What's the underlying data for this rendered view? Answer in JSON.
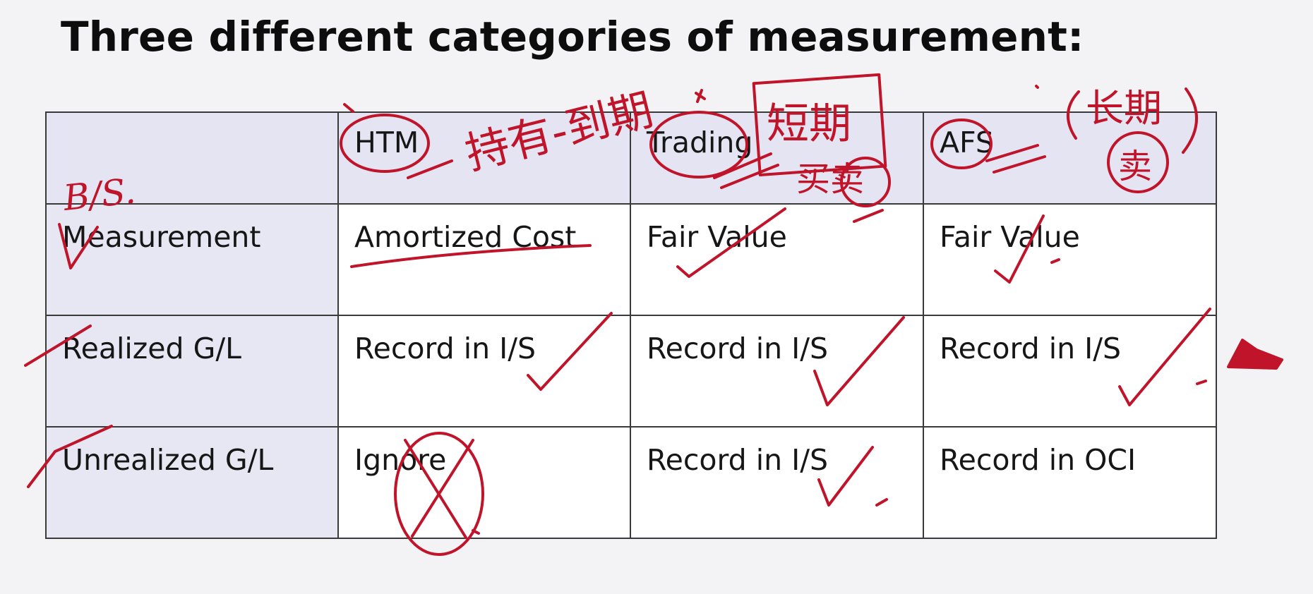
{
  "slide": {
    "title": "Three different categories of measurement:"
  },
  "table": {
    "columns": [
      "",
      "HTM",
      "Trading",
      "AFS"
    ],
    "rows": [
      {
        "label": "Measurement",
        "cells": [
          "Amortized Cost",
          "Fair Value",
          "Fair Value"
        ]
      },
      {
        "label": "Realized G/L",
        "cells": [
          "Record in I/S",
          "Record in I/S",
          "Record in I/S"
        ]
      },
      {
        "label": "Unrealized G/L",
        "cells": [
          "Ignore",
          "Record in I/S",
          "Record in OCI"
        ]
      }
    ]
  },
  "handwriting": {
    "ink_color": "#c0142a",
    "bs_note": "B/S.",
    "htm_note": "持有-到期",
    "trading_note": "短期",
    "trading_note_2": "买卖",
    "afs_note": "长期",
    "afs_note_2": "卖"
  }
}
